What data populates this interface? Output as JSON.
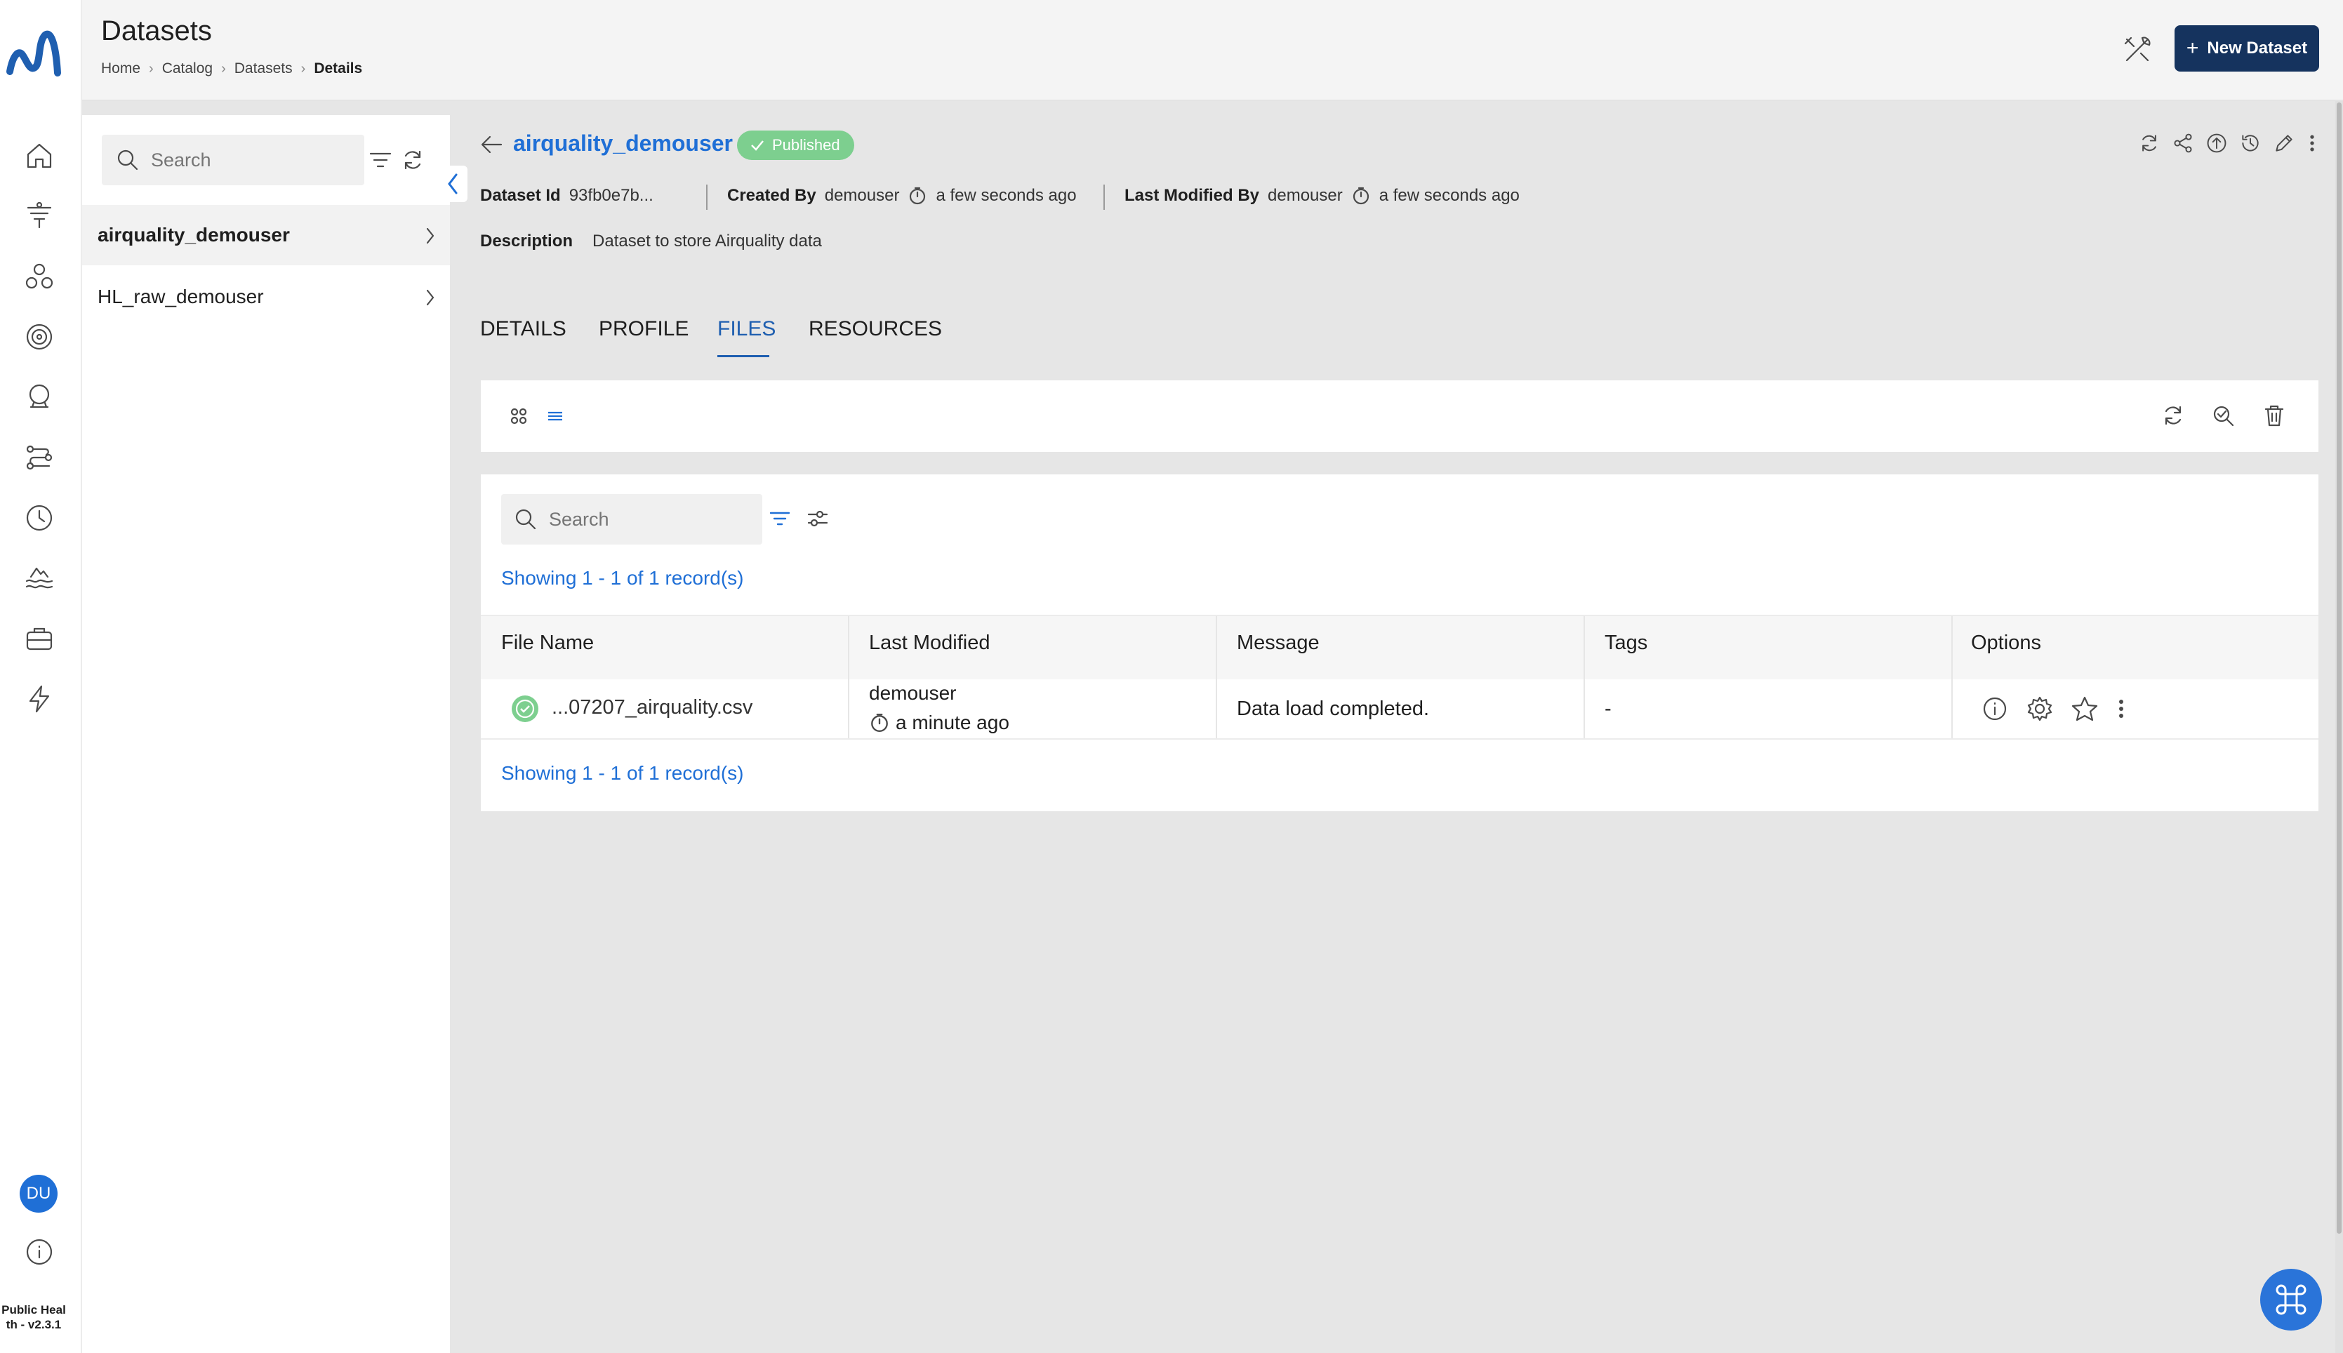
{
  "header": {
    "title": "Datasets",
    "breadcrumb": [
      "Home",
      "Catalog",
      "Datasets",
      "Details"
    ],
    "new_dataset_label": "New Dataset"
  },
  "rail": {
    "avatar_initials": "DU",
    "version_line1": "Public Heal",
    "version_line2": "th - v2.3.1",
    "icons": [
      "home-icon",
      "filter-funnel-icon",
      "cluster-icon",
      "target-icon",
      "crystal-ball-icon",
      "pipeline-icon",
      "clock-icon",
      "lake-icon",
      "briefcase-icon",
      "bolt-icon",
      "info-icon"
    ]
  },
  "list": {
    "search_placeholder": "Search",
    "items": [
      {
        "label": "airquality_demouser",
        "selected": true
      },
      {
        "label": "HL_raw_demouser",
        "selected": false
      }
    ]
  },
  "detail": {
    "name": "airquality_demouser",
    "status": "Published",
    "dataset_id_label": "Dataset Id",
    "dataset_id": "93fb0e7b...",
    "created_by_label": "Created By",
    "created_by": "demouser",
    "created_time": "a few seconds ago",
    "modified_by_label": "Last Modified By",
    "modified_by": "demouser",
    "modified_time": "a few seconds ago",
    "description_label": "Description",
    "description": "Dataset to store Airquality data"
  },
  "tabs": [
    {
      "label": "DETAILS",
      "active": false
    },
    {
      "label": "PROFILE",
      "active": false
    },
    {
      "label": "FILES",
      "active": true
    },
    {
      "label": "RESOURCES",
      "active": false
    }
  ],
  "files": {
    "search_placeholder": "Search",
    "showing_text": "Showing 1 - 1 of 1 record(s)",
    "columns": [
      "File Name",
      "Last Modified",
      "Message",
      "Tags",
      "Options"
    ],
    "rows": [
      {
        "file_name": "...07207_airquality.csv",
        "modified_by": "demouser",
        "modified_time": "a minute ago",
        "message": "Data load completed.",
        "tags": "-"
      }
    ]
  },
  "colors": {
    "accent": "#1f6fd6",
    "primary_button": "#15335e",
    "success": "#7dcf8f",
    "content_bg": "#e6e6e6"
  }
}
